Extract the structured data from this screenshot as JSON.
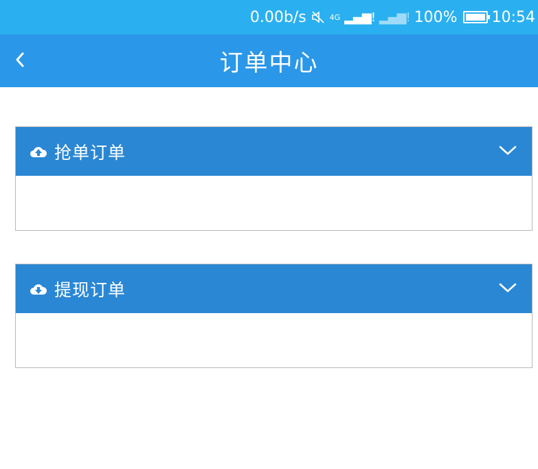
{
  "status_bar": {
    "net_speed": "0.00b/s",
    "network_type": "4G",
    "battery_percent": "100%",
    "time": "10:54",
    "icons": [
      "mute-icon",
      "signal-4g-icon",
      "signal-icon",
      "battery-icon"
    ]
  },
  "nav": {
    "title": "订单中心",
    "back_icon": "back-chevron-icon"
  },
  "panels": [
    {
      "title": "抢单订单",
      "icon": "cloud-upload-icon",
      "expand_icon": "chevron-down-icon"
    },
    {
      "title": "提现订单",
      "icon": "cloud-download-icon",
      "expand_icon": "chevron-down-icon"
    }
  ],
  "colors": {
    "status_bar": "#2ab0f0",
    "nav_bar": "#2b97e8",
    "panel_header": "#2a87d4",
    "panel_border": "#b8b8b8"
  }
}
